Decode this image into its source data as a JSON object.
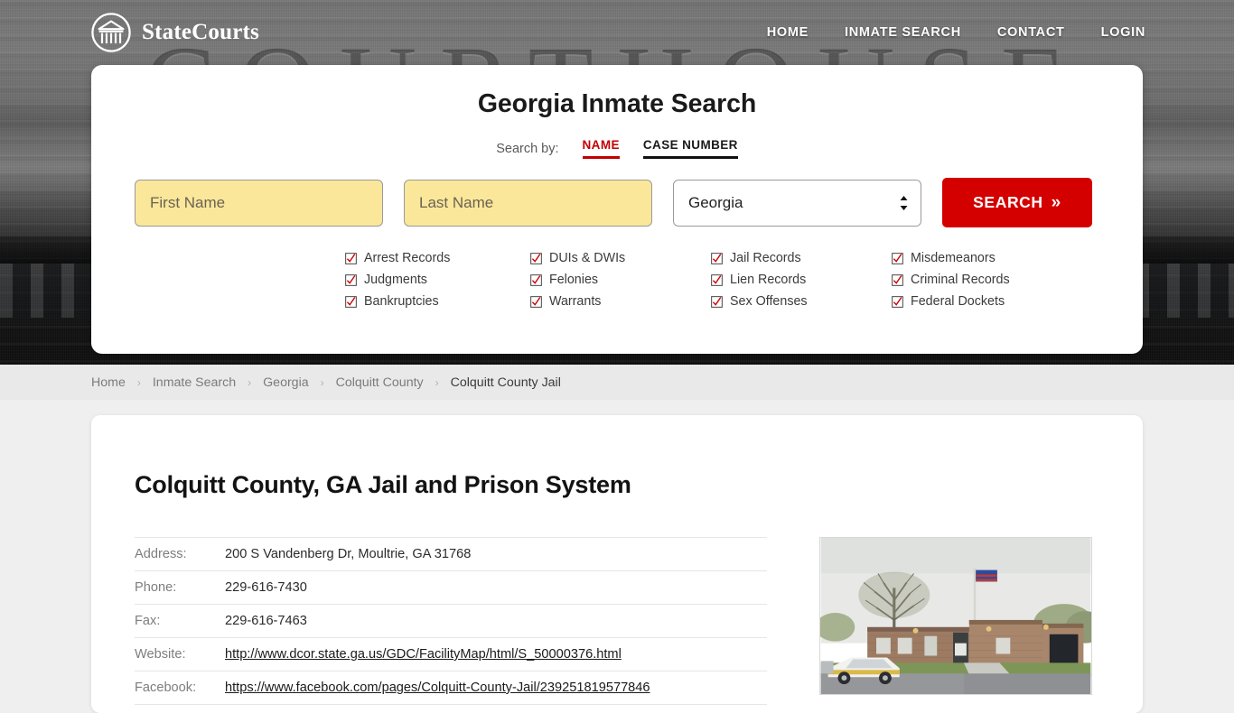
{
  "site": {
    "brand_name": "StateCourts",
    "logo_icon": "courthouse-circle-icon",
    "hero_background_word": "COURTHOUSE"
  },
  "nav": {
    "items": [
      {
        "label": "HOME"
      },
      {
        "label": "INMATE SEARCH"
      },
      {
        "label": "CONTACT"
      },
      {
        "label": "LOGIN"
      }
    ]
  },
  "search_card": {
    "title": "Georgia Inmate Search",
    "search_by_label": "Search by:",
    "tabs": [
      {
        "label": "NAME",
        "active": true
      },
      {
        "label": "CASE NUMBER",
        "active": false
      }
    ],
    "first_name": {
      "value": "",
      "placeholder": "First Name"
    },
    "last_name": {
      "value": "",
      "placeholder": "Last Name"
    },
    "state_select": {
      "value": "Georgia",
      "options": [
        "Georgia"
      ]
    },
    "submit_label": "SEARCH",
    "submit_chevron": "»",
    "record_types": [
      "Arrest Records",
      "DUIs & DWIs",
      "Jail Records",
      "Misdemeanors",
      "Judgments",
      "Felonies",
      "Lien Records",
      "Criminal Records",
      "Bankruptcies",
      "Warrants",
      "Sex Offenses",
      "Federal Dockets"
    ]
  },
  "breadcrumb": {
    "separator": "›",
    "items": [
      {
        "label": "Home",
        "current": false
      },
      {
        "label": "Inmate Search",
        "current": false
      },
      {
        "label": "Georgia",
        "current": false
      },
      {
        "label": "Colquitt County",
        "current": false
      },
      {
        "label": "Colquitt County Jail",
        "current": true
      }
    ]
  },
  "main": {
    "title": "Colquitt County, GA Jail and Prison System",
    "details": [
      {
        "label": "Address:",
        "value": "200 S Vandenberg Dr, Moultrie, GA 31768",
        "link": false
      },
      {
        "label": "Phone:",
        "value": "229-616-7430",
        "link": false
      },
      {
        "label": "Fax:",
        "value": "229-616-7463",
        "link": false
      },
      {
        "label": "Website:",
        "value": "http://www.dcor.state.ga.us/GDC/FacilityMap/html/S_50000376.html",
        "link": true
      },
      {
        "label": "Facebook:",
        "value": "https://www.facebook.com/pages/Colquitt-County-Jail/239251819577846",
        "link": true
      }
    ],
    "photo_alt": "Colquitt County Jail building exterior"
  },
  "colors": {
    "accent_red": "#d40000",
    "tab_active_red": "#c20000",
    "field_autofill_yellow": "#fbe79a",
    "page_bg": "#efefef",
    "breadcrumb_bg": "#e9e9e9"
  }
}
